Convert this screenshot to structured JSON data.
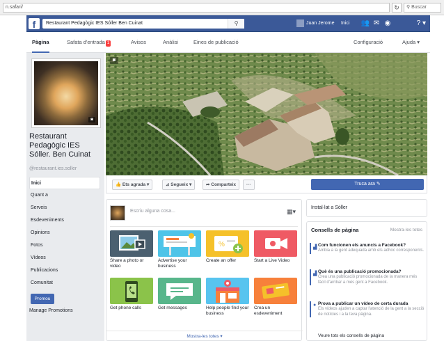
{
  "browser": {
    "url": "n.safari/",
    "reload": "↻",
    "search_placeholder": "Buscar"
  },
  "topbar": {
    "logo": "f",
    "search_value": "Restaurant Pedagògic IES Sóller Ben Cuinat",
    "search_icon": "⚲",
    "user_name": "Juan Jerome",
    "home": "Inici",
    "icons": [
      "friends-icon",
      "messages-icon",
      "notifications-icon"
    ],
    "help_icon": "?"
  },
  "tabs": {
    "pagina": "Pàgina",
    "safata": "Safata d'entrada",
    "safata_badge": "1",
    "avisos": "Avisos",
    "analisi": "Anàlisi",
    "eines": "Eines de publicació",
    "configuracio": "Configuració",
    "ajuda": "Ajuda"
  },
  "profile": {
    "name": "Restaurant Pedagògic IES Sóller. Ben Cuinat",
    "handle": "@restaurant.ies.soller"
  },
  "left_nav": {
    "items": [
      "Inici",
      "Quant a",
      "Serveis",
      "Esdeveniments",
      "Opinions",
      "Fotos",
      "Vídeos",
      "Publicacions",
      "Comunitat"
    ],
    "promote": "Promou",
    "manage_promotions": "Manage Promotions"
  },
  "actions": {
    "liked": "Ets agrada",
    "following": "Segueix",
    "share": "Comparteix",
    "more": "···",
    "cta": "Truca ara"
  },
  "composer": {
    "placeholder": "Escriu alguna cosa...",
    "tiles": [
      {
        "label": "Share a photo or video",
        "color": "#4b6070"
      },
      {
        "label": "Advertise your business",
        "color": "#4fc4e8"
      },
      {
        "label": "Create an offer",
        "color": "#f5c12a"
      },
      {
        "label": "Start a Live Video",
        "color": "#ef5a64"
      },
      {
        "label": "Get phone calls",
        "color": "#8bc34a"
      },
      {
        "label": "Get messages",
        "color": "#58b68b"
      },
      {
        "label": "Help people find your business",
        "color": "#58c4ef"
      },
      {
        "label": "Crea un esdeveniment",
        "color": "#f7803b"
      }
    ],
    "see_all": "Mostra-les totes"
  },
  "right": {
    "install": "Instal·lat a Sóller",
    "tips_title": "Consells de pàgina",
    "tips_all": "Mostra-les totes",
    "tips": [
      {
        "title": "Com funcionen els anuncis a Facebook?",
        "desc": "Ambia a la gent adequada amb els adhoc corresponents."
      },
      {
        "title": "Què és una publicació promocionada?",
        "desc": "Crea una publicació promocionada de la manera més fàcil d'arribar a més gent a Facebook."
      },
      {
        "title": "Prova a publicar un vídeo de certa durada",
        "desc": "Els vídeos ajuden a captar l'atenció de la gent a la secció de notícies i a la teva pàgina."
      }
    ],
    "more": "Veure tots els consells de pàgina"
  }
}
